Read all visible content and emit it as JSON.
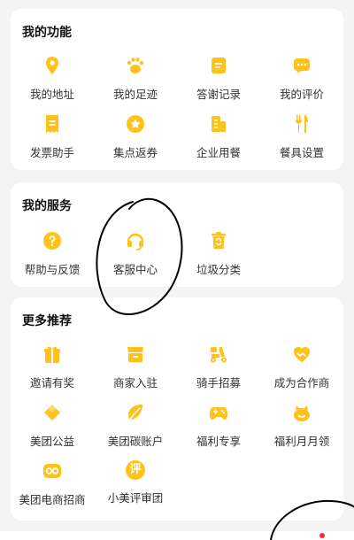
{
  "colors": {
    "accent": "#FFC21A",
    "background": "#F4F4F4",
    "card": "#FFFFFF",
    "badge": "#E8322B"
  },
  "sections": {
    "functions": {
      "title": "我的功能",
      "items": [
        {
          "label": "我的地址",
          "icon": "location-pin-icon"
        },
        {
          "label": "我的足迹",
          "icon": "footprint-icon"
        },
        {
          "label": "答谢记录",
          "icon": "document-icon"
        },
        {
          "label": "我的评价",
          "icon": "comment-icon"
        },
        {
          "label": "发票助手",
          "icon": "invoice-icon"
        },
        {
          "label": "集点返券",
          "icon": "star-coupon-icon"
        },
        {
          "label": "企业用餐",
          "icon": "building-icon"
        },
        {
          "label": "餐具设置",
          "icon": "cutlery-icon"
        }
      ]
    },
    "services": {
      "title": "我的服务",
      "items": [
        {
          "label": "帮助与反馈",
          "icon": "help-question-icon"
        },
        {
          "label": "客服中心",
          "icon": "headset-icon"
        },
        {
          "label": "垃圾分类",
          "icon": "trash-bin-icon"
        }
      ]
    },
    "recommend": {
      "title": "更多推荐",
      "items": [
        {
          "label": "邀请有奖",
          "icon": "gift-icon"
        },
        {
          "label": "商家入驻",
          "icon": "shop-icon"
        },
        {
          "label": "骑手招募",
          "icon": "scooter-icon"
        },
        {
          "label": "成为合作商",
          "icon": "handshake-heart-icon"
        },
        {
          "label": "美团公益",
          "icon": "charity-heart-icon"
        },
        {
          "label": "美团碳账户",
          "icon": "leaf-icon"
        },
        {
          "label": "福利专享",
          "icon": "gamepad-icon"
        },
        {
          "label": "福利月月领",
          "icon": "face-gift-icon"
        },
        {
          "label": "美团电商招商",
          "icon": "infinity-icon"
        },
        {
          "label": "小美评审团",
          "icon": "review-badge-icon"
        }
      ],
      "review_badge_char": "评"
    }
  }
}
